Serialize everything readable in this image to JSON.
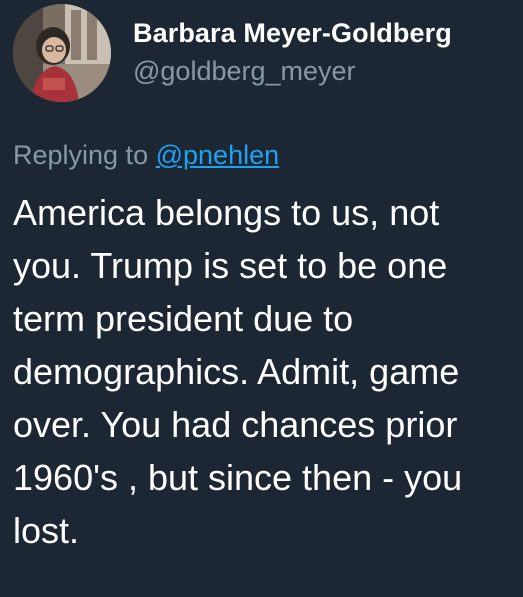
{
  "user": {
    "display_name": "Barbara Meyer-Goldberg",
    "handle": "@goldberg_meyer",
    "avatar_icon": "profile-photo"
  },
  "reply": {
    "prefix": "Replying to",
    "mention": "@pnehlen"
  },
  "tweet": {
    "lines": [
      "America belongs to us, not",
      "you. Trump is set to be one",
      "term president due to",
      "demographics. Admit, game",
      "over. You had chances prior",
      "1960's , but since then - you",
      "lost."
    ]
  },
  "colors": {
    "background": "#1c2733",
    "text": "#ffffff",
    "secondary": "#8899a6",
    "link": "#1da1f2"
  }
}
